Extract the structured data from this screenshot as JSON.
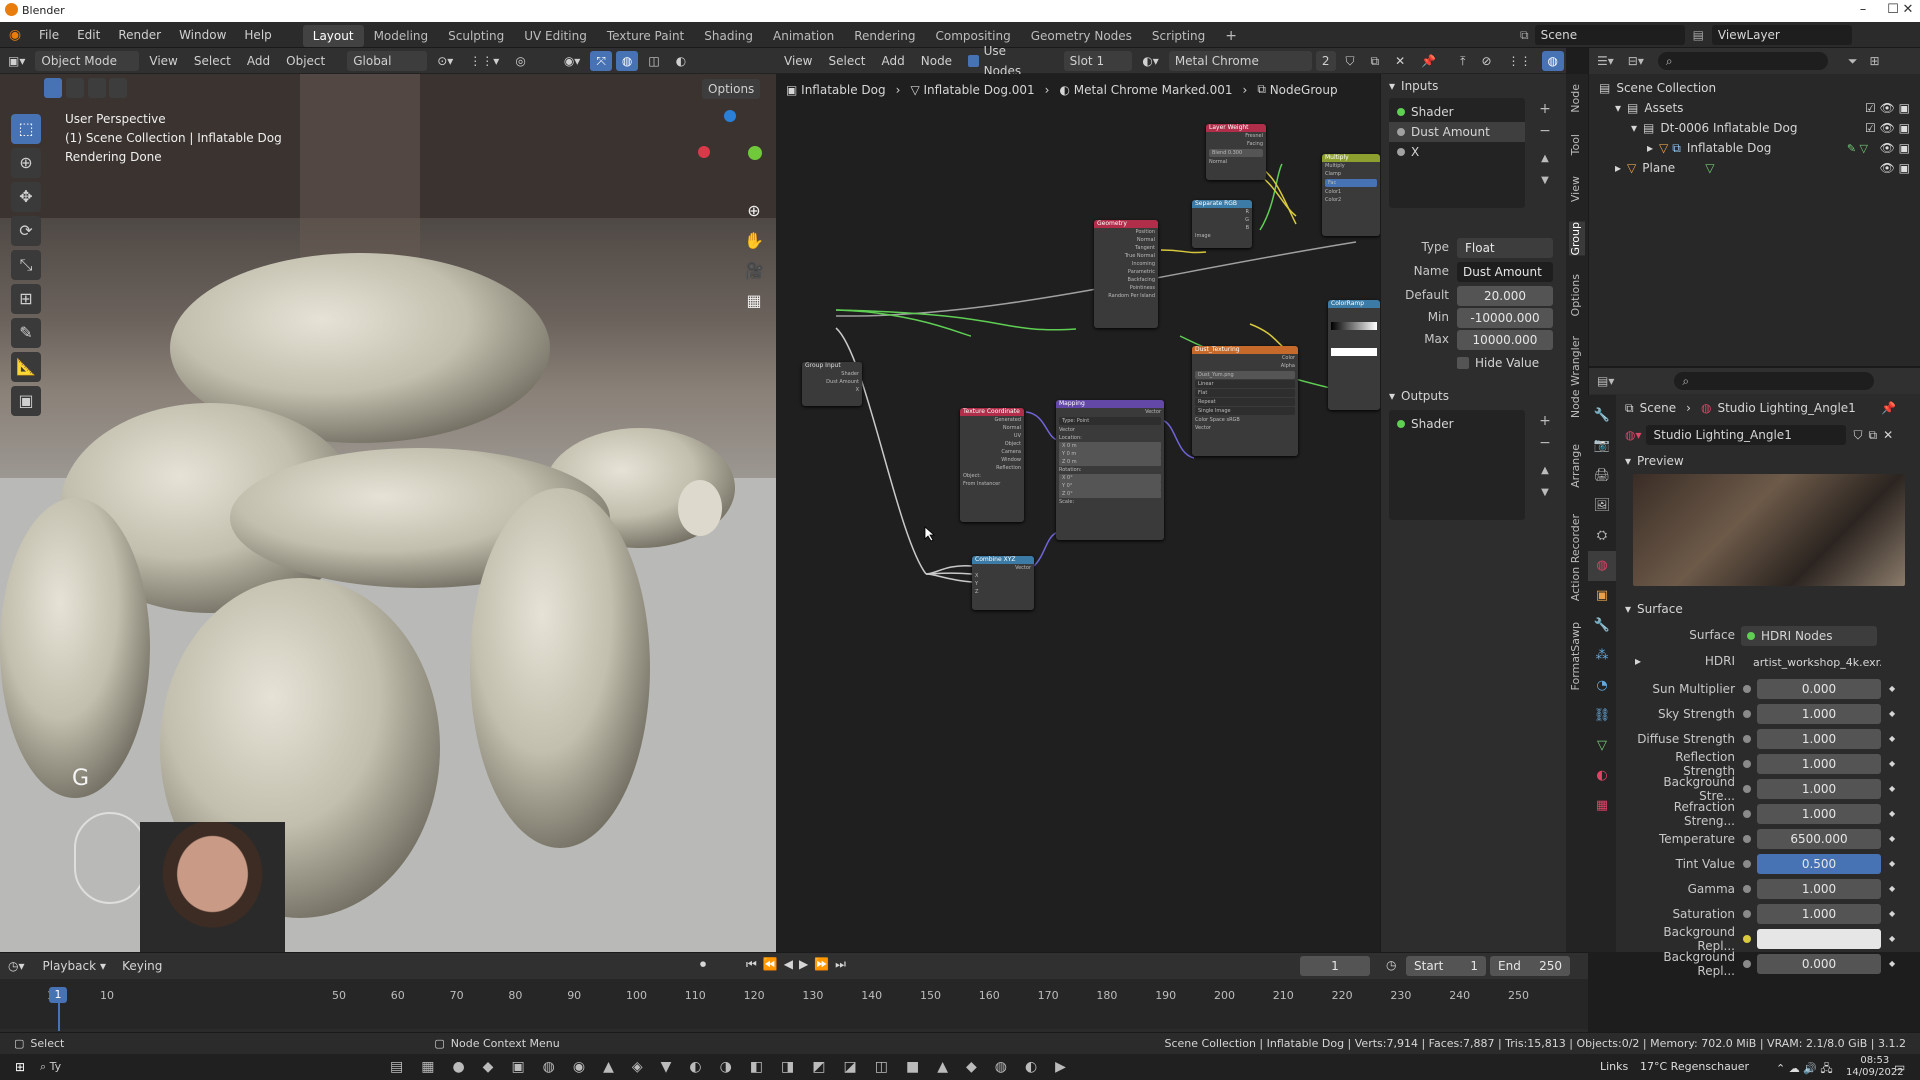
{
  "window": {
    "title": "Blender",
    "controls": [
      "–",
      "☐",
      "✕"
    ]
  },
  "menu": {
    "items": [
      "File",
      "Edit",
      "Render",
      "Window",
      "Help"
    ],
    "workspaces": [
      "Layout",
      "Modeling",
      "Sculpting",
      "UV Editing",
      "Texture Paint",
      "Shading",
      "Animation",
      "Rendering",
      "Compositing",
      "Geometry Nodes",
      "Scripting"
    ],
    "active_workspace": "Layout",
    "scene": "Scene",
    "view_layer": "ViewLayer"
  },
  "viewport": {
    "mode": "Object Mode",
    "menus": [
      "View",
      "Select",
      "Add",
      "Object"
    ],
    "transform": "Global",
    "options": "Options",
    "overlay_lines": [
      "User Perspective",
      "(1) Scene Collection | Inflatable Dog",
      "Rendering Done"
    ],
    "key_hint": "G"
  },
  "node_editor": {
    "menus": [
      "View",
      "Select",
      "Add",
      "Node"
    ],
    "use_nodes_label": "Use Nodes",
    "slot": "Slot 1",
    "material": "Metal Chrome Marked.001",
    "users": "2",
    "breadcrumb": [
      "Inflatable Dog",
      "Inflatable Dog.001",
      "Metal Chrome Marked.001",
      "NodeGroup"
    ],
    "nodes": {
      "layer_weight": {
        "title": "Layer Weight",
        "rows": [
          "Fresnel",
          "Facing",
          "Blend 0.300",
          "Normal"
        ]
      },
      "multiply": {
        "title": "Multiply",
        "rows": [
          "Multiply",
          "Clamp",
          "Fac",
          "Color1",
          "Color2"
        ]
      },
      "separate_rgb": {
        "title": "Separate RGB",
        "rows": [
          "R",
          "G",
          "B",
          "Image"
        ]
      },
      "geometry": {
        "title": "Geometry",
        "rows": [
          "Position",
          "Normal",
          "Tangent",
          "True Normal",
          "Incoming",
          "Parametric",
          "Backfacing",
          "Pointiness",
          "Random Per Island"
        ]
      },
      "color_ramp": {
        "title": "ColorRamp"
      },
      "group_input": {
        "title": "Group Input",
        "rows": [
          "Shader",
          "Dust Amount",
          "X"
        ]
      },
      "dust_texture": {
        "title": "Dust_Texturing",
        "rows": [
          "Color",
          "Alpha",
          "Dust_Yum.png",
          "Linear",
          "Flat",
          "Repeat",
          "Single Image",
          "Color Space sRGB",
          "Vector"
        ]
      },
      "tex_coord": {
        "title": "Texture Coordinate",
        "rows": [
          "Generated",
          "Normal",
          "UV",
          "Object",
          "Camera",
          "Window",
          "Reflection",
          "Object:",
          "From Instancer"
        ]
      },
      "mapping": {
        "title": "Mapping",
        "rows": [
          "Vector",
          "Type: Point",
          "Vector",
          "Location:",
          "X 0 m",
          "Y 0 m",
          "Z 0 m",
          "Rotation:",
          "X 0°",
          "Y 0°",
          "Z 0°",
          "Scale:"
        ]
      },
      "combine_xyz": {
        "title": "Combine XYZ",
        "rows": [
          "Vector",
          "X",
          "Y",
          "Z"
        ]
      }
    }
  },
  "group_panel": {
    "inputs_header": "Inputs",
    "inputs": [
      "Shader",
      "Dust Amount",
      "X"
    ],
    "active_input": "Dust Amount",
    "type_label": "Type",
    "type_value": "Float",
    "name_label": "Name",
    "name_value": "Dust Amount",
    "default_label": "Default",
    "default_value": "20.000",
    "min_label": "Min",
    "min_value": "-10000.000",
    "max_label": "Max",
    "max_value": "10000.000",
    "hide_value_label": "Hide Value",
    "outputs_header": "Outputs",
    "outputs": [
      "Shader"
    ]
  },
  "sidebar_tabs": [
    "Node",
    "Tool",
    "View",
    "Group",
    "Options",
    "Node Wrangler",
    "Arrange",
    "Action Recorder",
    "FormatSawp"
  ],
  "outliner": {
    "root": "Scene Collection",
    "items": [
      {
        "label": "Assets",
        "indent": 1
      },
      {
        "label": "Dt-0006 Inflatable Dog",
        "indent": 2
      },
      {
        "label": "Inflatable Dog",
        "indent": 3
      },
      {
        "label": "Plane",
        "indent": 1
      }
    ]
  },
  "properties": {
    "breadcrumb": [
      "Scene",
      "Studio Lighting_Angle1"
    ],
    "world_name": "Studio Lighting_Angle1",
    "preview_label": "Preview",
    "surface_header": "Surface",
    "surface_label": "Surface",
    "surface_value": "HDRI Nodes",
    "hdri_label": "HDRI",
    "hdri_value": "artist_workshop_4k.exr...",
    "params": [
      {
        "label": "Sun Multiplier",
        "value": "0.000"
      },
      {
        "label": "Sky Strength",
        "value": "1.000"
      },
      {
        "label": "Diffuse Strength",
        "value": "1.000"
      },
      {
        "label": "Reflection Strength",
        "value": "1.000"
      },
      {
        "label": "Background Stre...",
        "value": "1.000"
      },
      {
        "label": "Refraction Streng...",
        "value": "1.000"
      },
      {
        "label": "Temperature",
        "value": "6500.000"
      },
      {
        "label": "Tint Value",
        "value": "0.500"
      },
      {
        "label": "Gamma",
        "value": "1.000"
      },
      {
        "label": "Saturation",
        "value": "1.000"
      },
      {
        "label": "Background Repl...",
        "value": ""
      },
      {
        "label": "Background Repl...",
        "value": "0.000"
      }
    ]
  },
  "timeline": {
    "playback": "Playback",
    "keying": "Keying",
    "current_frame": "1",
    "start_label": "Start",
    "start": "1",
    "end_label": "End",
    "end": "250",
    "ticks": [
      "1",
      "10",
      "50",
      "60",
      "70",
      "80",
      "90",
      "100",
      "110",
      "120",
      "130",
      "140",
      "150",
      "160",
      "170",
      "180",
      "190",
      "200",
      "210",
      "220",
      "230",
      "240",
      "250"
    ]
  },
  "status": {
    "left": "Select",
    "middle": "Node Context Menu",
    "right": "Scene Collection | Inflatable Dog | Verts:7,914 | Faces:7,887 | Tris:15,813 | Objects:0/2 | Memory: 702.0 MiB | VRAM: 2.1/8.0 GiB | 3.1.2"
  },
  "taskbar": {
    "search_hint": "Ty",
    "links": "Links",
    "weather": "17°C  Regenschauer",
    "time": "08:53",
    "date": "14/09/2022"
  },
  "colors": {
    "accent": "#4772b3",
    "header_layer_weight": "#b02e4a",
    "header_multiply": "#8d9f2e",
    "header_separate": "#3c7ba5",
    "header_geometry": "#b02e4a",
    "header_texture": "#c56a2a",
    "header_mapping": "#6448a8",
    "header_combine": "#3c7ba5",
    "link_green": "#5fcf54",
    "link_grey": "#a0a0a0",
    "link_yellow": "#d9c93d",
    "link_purple": "#7065d8"
  }
}
